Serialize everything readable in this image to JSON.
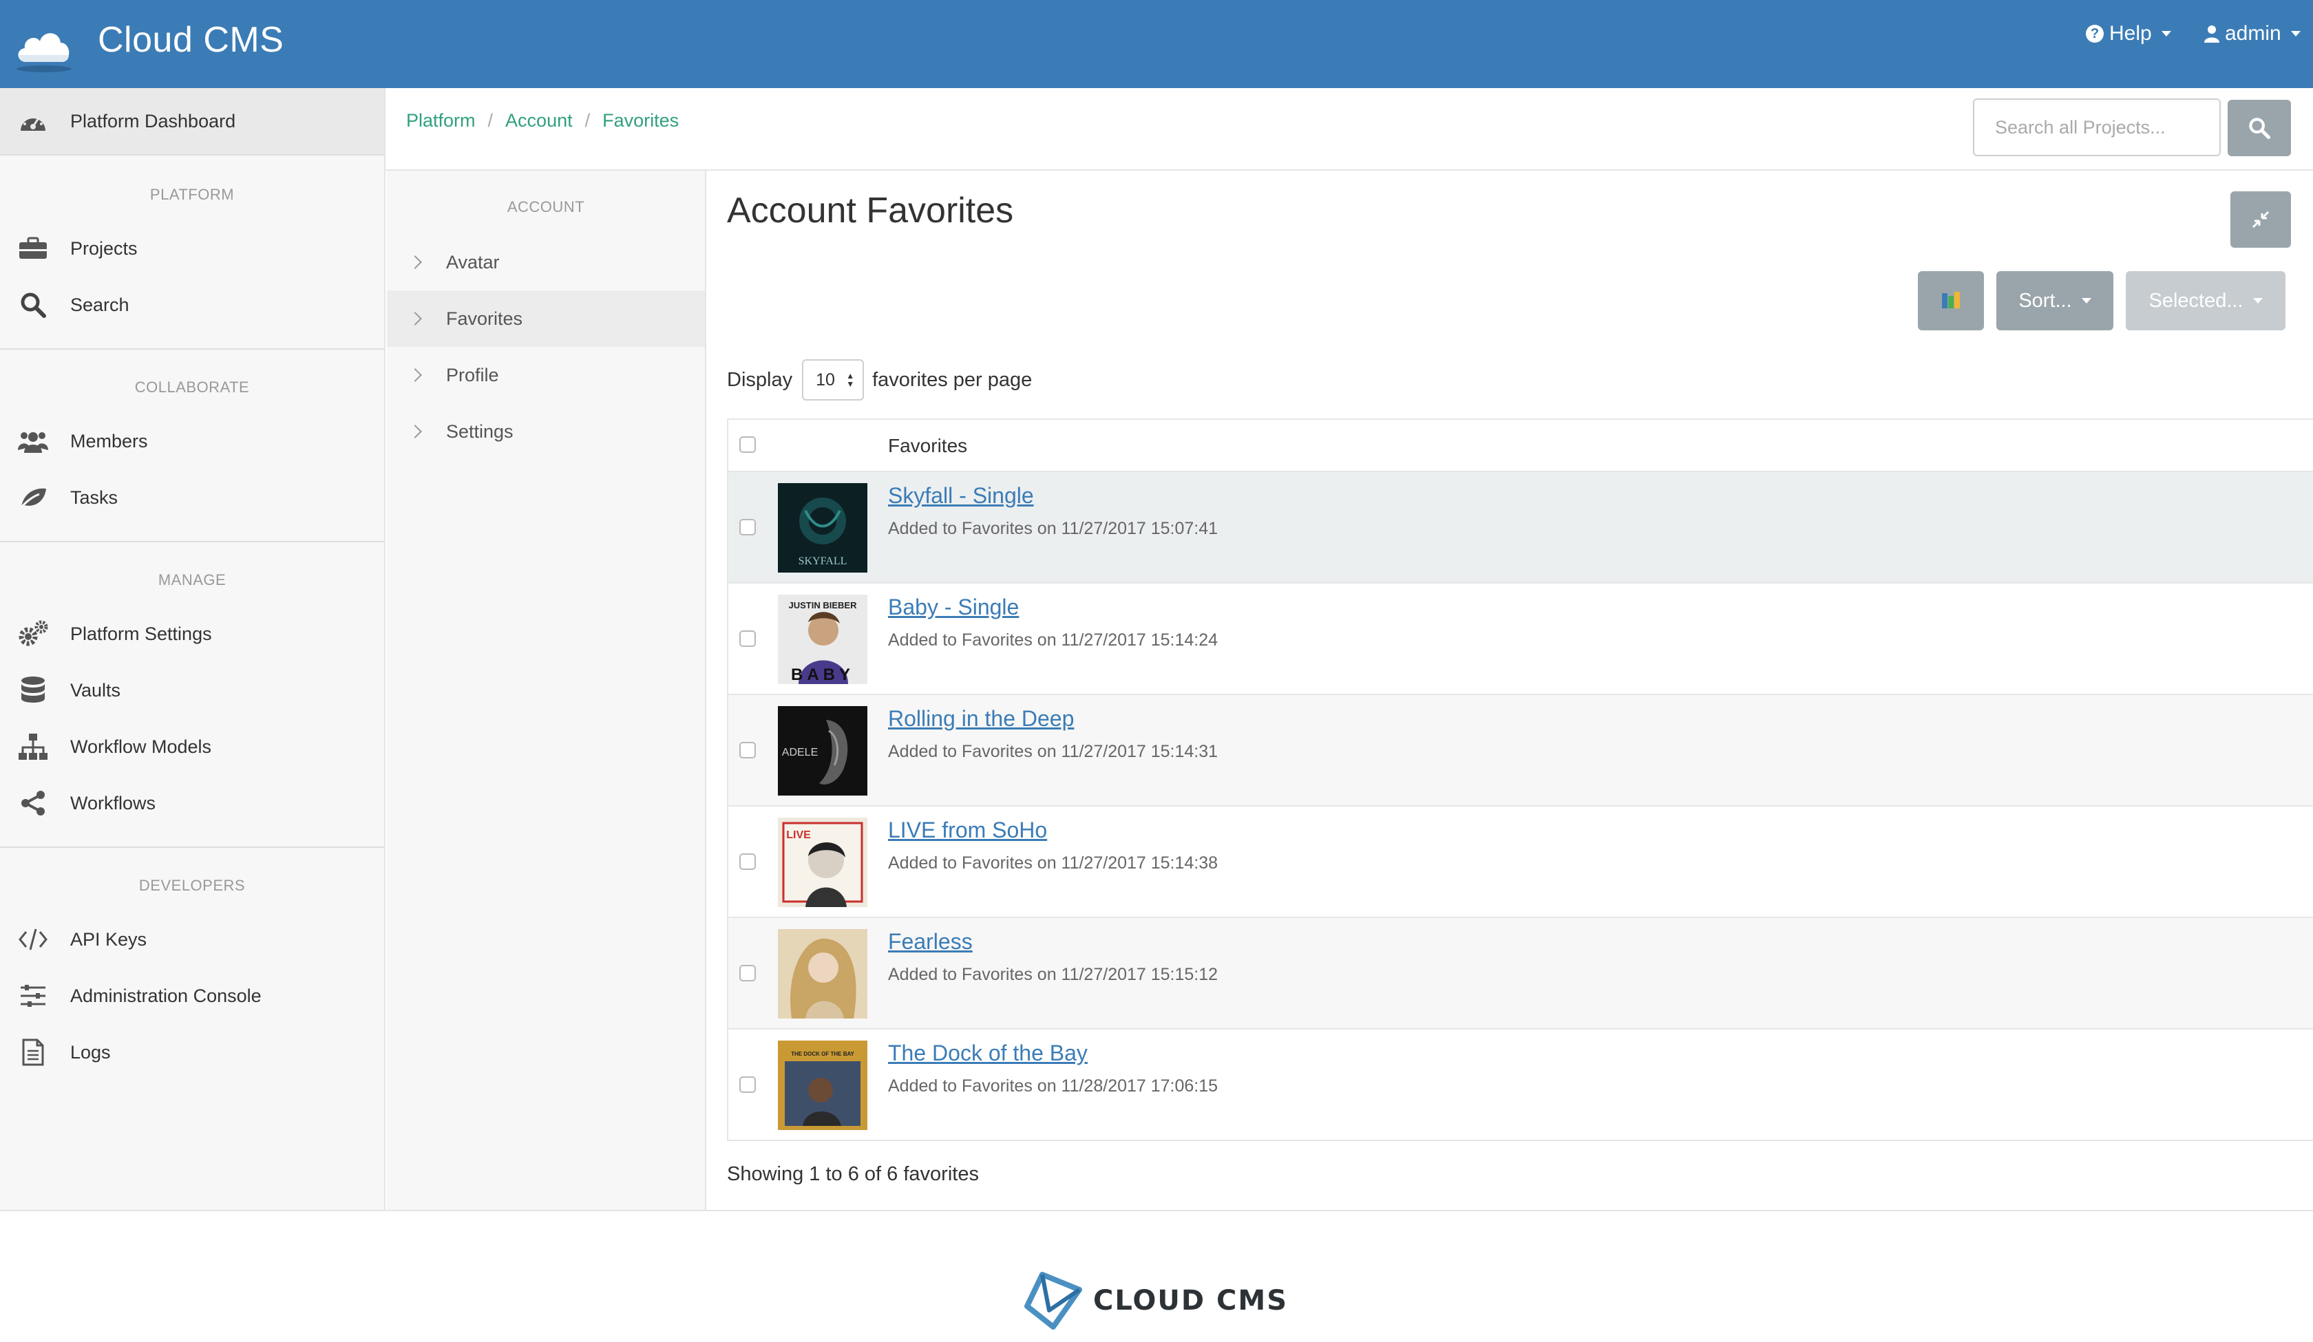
{
  "app": {
    "title": "Cloud CMS"
  },
  "topbar": {
    "help_label": "Help",
    "user_label": "admin"
  },
  "sidebar": {
    "dashboard_label": "Platform Dashboard",
    "sections": {
      "platform": "PLATFORM",
      "collaborate": "COLLABORATE",
      "manage": "MANAGE",
      "developers": "DEVELOPERS"
    },
    "items": {
      "projects": "Projects",
      "search": "Search",
      "members": "Members",
      "tasks": "Tasks",
      "platform_settings": "Platform Settings",
      "vaults": "Vaults",
      "workflow_models": "Workflow Models",
      "workflows": "Workflows",
      "api_keys": "API Keys",
      "admin_console": "Administration Console",
      "logs": "Logs"
    }
  },
  "breadcrumb": [
    "Platform",
    "Account",
    "Favorites"
  ],
  "search": {
    "placeholder": "Search all Projects...",
    "value": ""
  },
  "subnav": {
    "title": "ACCOUNT",
    "items": [
      "Avatar",
      "Favorites",
      "Profile",
      "Settings"
    ],
    "active": "Favorites"
  },
  "main": {
    "title": "Account Favorites",
    "sort_label": "Sort...",
    "selected_label": "Selected...",
    "display_label": "Display",
    "per_page_value": "10",
    "per_page_suffix": "favorites per page",
    "table_header": "Favorites",
    "showing": "Showing 1 to 6 of 6 favorites"
  },
  "favorites": [
    {
      "title": "Skyfall - Single",
      "added": "Added to Favorites on 11/27/2017 15:07:41",
      "cover_text": "SKYFALL"
    },
    {
      "title": "Baby - Single",
      "added": "Added to Favorites on 11/27/2017 15:14:24",
      "cover_text": "BABY",
      "cover_top": "JUSTIN BIEBER"
    },
    {
      "title": "Rolling in the Deep",
      "added": "Added to Favorites on 11/27/2017 15:14:31",
      "cover_text": "ADELE"
    },
    {
      "title": "LIVE from SoHo",
      "added": "Added to Favorites on 11/27/2017 15:14:38",
      "cover_text": "LIVE"
    },
    {
      "title": "Fearless",
      "added": "Added to Favorites on 11/27/2017 15:15:12",
      "cover_text": ""
    },
    {
      "title": "The Dock of the Bay",
      "added": "Added to Favorites on 11/28/2017 17:06:15",
      "cover_text": "THE DOCK OF THE BAY"
    }
  ],
  "footer": {
    "logo_text": "CLOUD CMS"
  },
  "colors": {
    "brand": "#3b7cb6",
    "link_green": "#30a080",
    "button_gray": "#9aa5ab"
  }
}
